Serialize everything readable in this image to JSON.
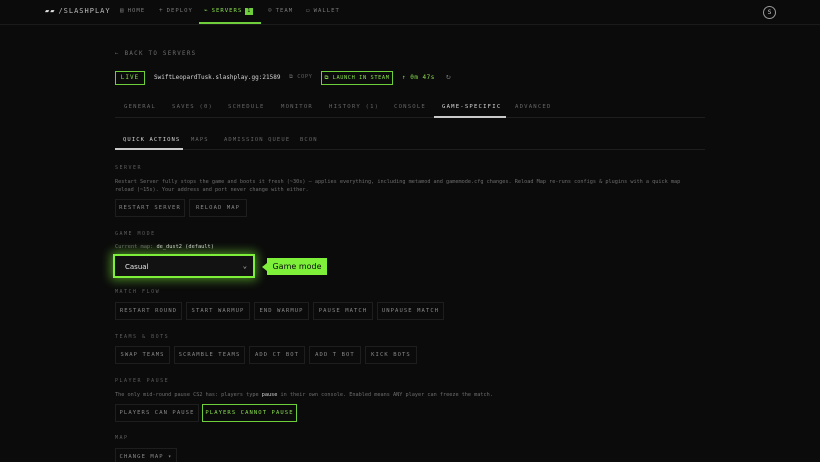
{
  "nav": {
    "logo_mark": "▰▰",
    "logo": "/SLASHPLAY",
    "items": [
      {
        "icon": "▤",
        "label": "HOME"
      },
      {
        "icon": "+",
        "label": "DEPLOY"
      },
      {
        "icon": "⌁",
        "label": "SERVERS",
        "badge": "1"
      },
      {
        "icon": "☺",
        "label": "TEAM"
      },
      {
        "icon": "▭",
        "label": "WALLET"
      }
    ],
    "avatar": "S"
  },
  "back_label": "← BACK TO SERVERS",
  "server": {
    "status": "LIVE",
    "host": "SwiftLeopardTusk.slashplay.gg:21589",
    "copy_label": "⧉ COPY",
    "launch_label": "⧉ LAUNCH IN STEAM",
    "uptime": "↑ 0m 47s",
    "refresh_icon": "↻"
  },
  "tabs": [
    "GENERAL",
    "SAVES (0)",
    "SCHEDULE",
    "MONITOR",
    "HISTORY (1)",
    "CONSOLE",
    "GAME-SPECIFIC",
    "ADVANCED"
  ],
  "subtabs": [
    "QUICK ACTIONS",
    "MAPS",
    "ADMISSION QUEUE",
    "BCON"
  ],
  "server_section": {
    "title": "SERVER",
    "desc_line1": "Restart Server fully stops the game and boots it fresh (~30s) — applies everything, including metamod and gamemode.cfg changes. Reload Map re-runs configs & plugins with a quick map",
    "desc_line2": "reload (~15s). Your address and port never change with either.",
    "restart_label": "RESTART SERVER",
    "reload_label": "RELOAD MAP"
  },
  "game_mode": {
    "title": "GAME MODE",
    "current_prefix": "Current map:",
    "current_map": "de_dust2 (default)",
    "selected": "Casual",
    "tooltip": "Game mode"
  },
  "match_flow": {
    "title": "MATCH FLOW",
    "buttons": [
      "RESTART ROUND",
      "START WARMUP",
      "END WARMUP",
      "PAUSE MATCH",
      "UNPAUSE MATCH"
    ]
  },
  "teams": {
    "title": "TEAMS & BOTS",
    "buttons": [
      "SWAP TEAMS",
      "SCRAMBLE TEAMS",
      "ADD CT BOT",
      "ADD T BOT",
      "KICK BOTS"
    ]
  },
  "player_pause": {
    "title": "PLAYER PAUSE",
    "desc_pre": "The only mid-round pause CS2 has: players type",
    "desc_kw": "pause",
    "desc_post": "in their own console. Enabled means ANY player can freeze the match.",
    "can_label": "PLAYERS CAN PAUSE",
    "cannot_label": "PLAYERS CANNOT PAUSE"
  },
  "map_section": {
    "title": "MAP",
    "change_label": "CHANGE MAP ▾"
  }
}
